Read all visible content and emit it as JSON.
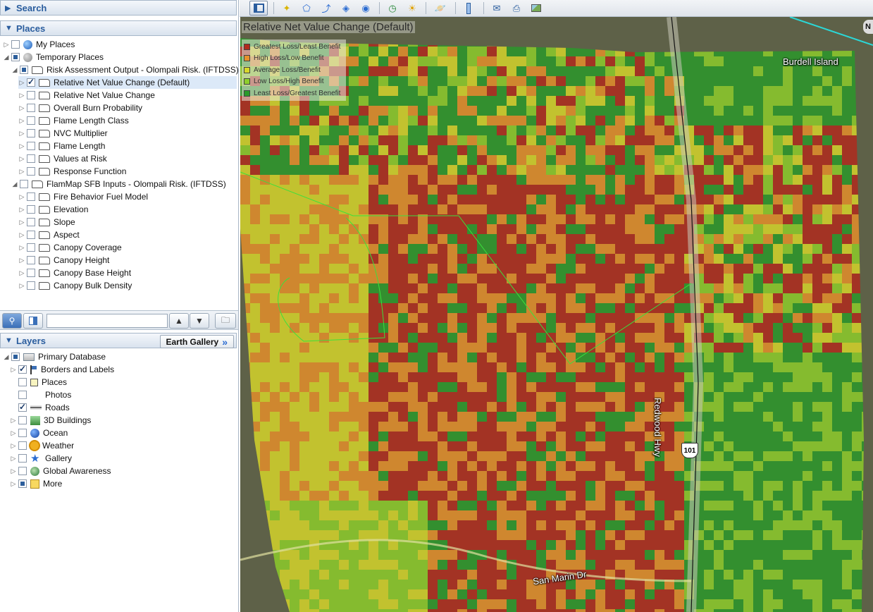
{
  "search_panel": {
    "title": "Search"
  },
  "places_panel": {
    "title": "Places",
    "items": [
      {
        "label": "My Places"
      },
      {
        "label": "Temporary Places"
      },
      {
        "label": "Risk Assessment Output - Olompali Risk. (IFTDSS)"
      },
      {
        "label": "Relative Net Value Change (Default)"
      },
      {
        "label": "Relative Net Value Change"
      },
      {
        "label": "Overall Burn Probability"
      },
      {
        "label": "Flame Length Class"
      },
      {
        "label": "NVC Multiplier"
      },
      {
        "label": "Flame Length"
      },
      {
        "label": "Values at Risk"
      },
      {
        "label": "Response Function"
      },
      {
        "label": "FlamMap SFB Inputs - Olompali Risk. (IFTDSS)"
      },
      {
        "label": "Fire Behavior Fuel Model"
      },
      {
        "label": "Elevation"
      },
      {
        "label": "Slope"
      },
      {
        "label": "Aspect"
      },
      {
        "label": "Canopy Coverage"
      },
      {
        "label": "Canopy Height"
      },
      {
        "label": "Canopy Base Height"
      },
      {
        "label": "Canopy Bulk Density"
      }
    ]
  },
  "layers_panel": {
    "title": "Layers",
    "gallery_button": "Earth Gallery",
    "items": [
      {
        "label": "Primary Database"
      },
      {
        "label": "Borders and Labels"
      },
      {
        "label": "Places"
      },
      {
        "label": "Photos"
      },
      {
        "label": "Roads"
      },
      {
        "label": "3D Buildings"
      },
      {
        "label": "Ocean"
      },
      {
        "label": "Weather"
      },
      {
        "label": "Gallery"
      },
      {
        "label": "Global Awareness"
      },
      {
        "label": "More"
      }
    ]
  },
  "map": {
    "legend_title": "Relative Net Value Change (Default)",
    "legend": [
      {
        "label": "Greatest Loss/Least Benefit",
        "color": "#b22a1c"
      },
      {
        "label": "High Loss/Low Benefit",
        "color": "#e8902a"
      },
      {
        "label": "Average Loss/Benefit",
        "color": "#d8d82a"
      },
      {
        "label": "Low Loss/High Benefit",
        "color": "#8ecf2a"
      },
      {
        "label": "Least Loss/Greatest Benefit",
        "color": "#2a9a2a"
      }
    ],
    "labels": {
      "burdell_island": "Burdell Island",
      "redwood_hwy": "Redwood Hwy",
      "san_marin_dr": "San Marin Dr",
      "route_shield": "101",
      "north": "N"
    }
  }
}
